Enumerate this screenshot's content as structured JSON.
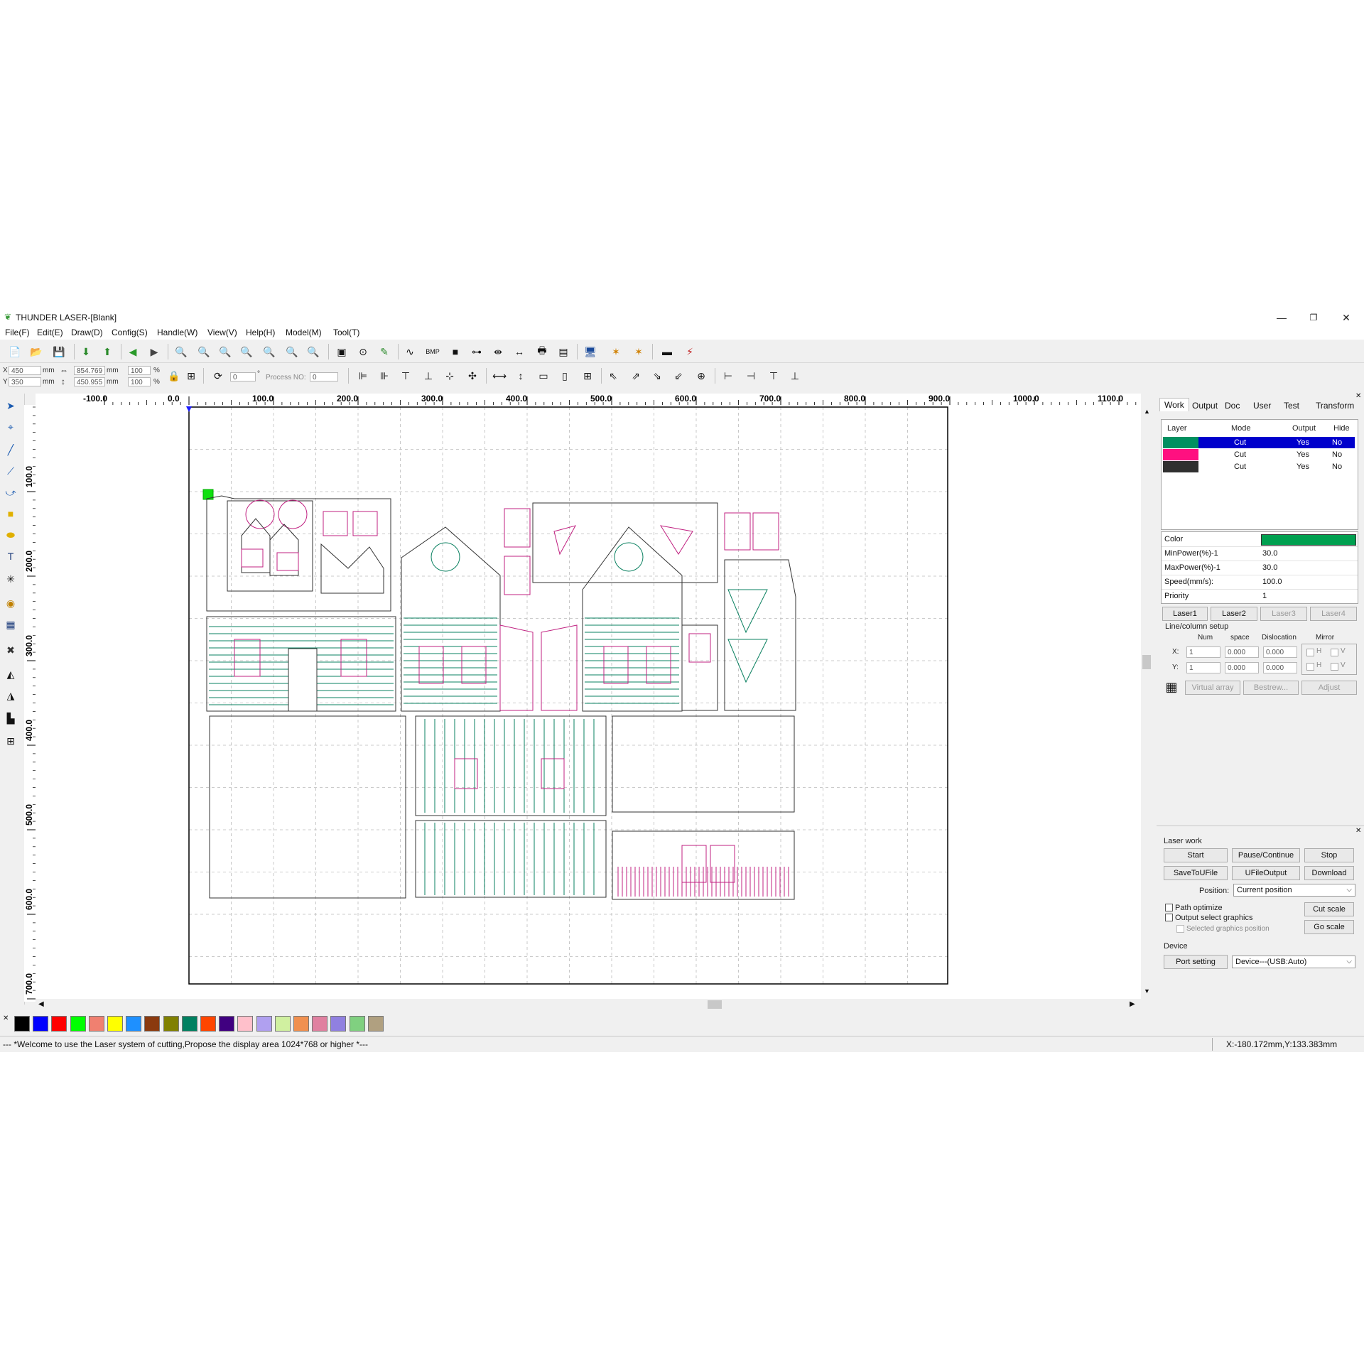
{
  "window": {
    "title": "THUNDER LASER-[Blank]",
    "minimize": "—",
    "maximize": "❐",
    "close": "✕"
  },
  "menu": [
    "File(F)",
    "Edit(E)",
    "Draw(D)",
    "Config(S)",
    "Handle(W)",
    "View(V)",
    "Help(H)",
    "Model(M)",
    "Tool(T)"
  ],
  "coords": {
    "x_label": "X",
    "x_value": "450",
    "x_unit": "mm",
    "y_label": "Y",
    "y_value": "350",
    "y_unit": "mm",
    "width_value": "854.769",
    "width_unit": "mm",
    "height_value": "450.955",
    "height_unit": "mm",
    "scale_w": "100",
    "scale_h": "100",
    "percent": "%",
    "rotate_value": "0",
    "degree": "°",
    "process_label": "Process NO:",
    "process_value": "0"
  },
  "ruler": {
    "h_labels": [
      "-100.0",
      "0.0",
      "100.0",
      "200.0",
      "300.0",
      "400.0",
      "500.0",
      "600.0",
      "700.0",
      "800.0",
      "900.0",
      "1000.0",
      "1100.0"
    ],
    "v_labels": [
      "100.0",
      "200.0",
      "300.0",
      "400.0",
      "500.0",
      "600.0",
      "700.0"
    ]
  },
  "palette_colors": [
    "#000000",
    "#0000ff",
    "#ff0000",
    "#00ff00",
    "#f08070",
    "#ffff00",
    "#1e90ff",
    "#8b3a0f",
    "#808000",
    "#008060",
    "#ff4500",
    "#400080",
    "#ffc0cb",
    "#b0a0f0",
    "#d0f0a0",
    "#f09050",
    "#e080a0",
    "#9080e0",
    "#80d080",
    "#b0a080"
  ],
  "status": {
    "message": "--- *Welcome to use the Laser system of cutting,Propose the display area 1024*768 or higher *---",
    "coordinates": "X:-180.172mm,Y:133.383mm"
  },
  "right_panel": {
    "tabs": [
      "Work",
      "Output",
      "Doc",
      "User",
      "Test",
      "Transform"
    ],
    "layer_headers": [
      "Layer",
      "Mode",
      "Output",
      "Hide"
    ],
    "layers": [
      {
        "color": "#009060",
        "mode": "Cut",
        "output": "Yes",
        "hide": "No"
      },
      {
        "color": "#ff1080",
        "mode": "Cut",
        "output": "Yes",
        "hide": "No"
      },
      {
        "color": "#303030",
        "mode": "Cut",
        "output": "Yes",
        "hide": "No"
      }
    ],
    "properties": [
      {
        "label": "Color",
        "value": ""
      },
      {
        "label": "MinPower(%)-1",
        "value": "30.0"
      },
      {
        "label": "MaxPower(%)-1",
        "value": "30.0"
      },
      {
        "label": "Speed(mm/s):",
        "value": "100.0"
      },
      {
        "label": "Priority",
        "value": "1"
      }
    ],
    "color_value": "#00a050",
    "laser_tabs": [
      "Laser1",
      "Laser2",
      "Laser3",
      "Laser4"
    ],
    "line_column": {
      "title": "Line/column setup",
      "headers": [
        "Num",
        "space",
        "Dislocation",
        "Mirror"
      ],
      "x_label": "X:",
      "y_label": "Y:",
      "x_num": "1",
      "x_space": "0.000",
      "x_disloc": "0.000",
      "y_num": "1",
      "y_space": "0.000",
      "y_disloc": "0.000",
      "mirror_h": "H",
      "mirror_v": "V"
    },
    "array_buttons": [
      "Virtual array",
      "Bestrew...",
      "Adjust"
    ],
    "laser_work": {
      "title": "Laser work",
      "start": "Start",
      "pause": "Pause/Continue",
      "stop": "Stop",
      "save": "SaveToUFile",
      "ufile": "UFileOutput",
      "download": "Download",
      "position_label": "Position:",
      "position_value": "Current position",
      "path_optimize": "Path optimize",
      "output_select": "Output select graphics",
      "selected_pos": "Selected graphics position",
      "cut_scale": "Cut scale",
      "go_scale": "Go scale"
    },
    "device": {
      "title": "Device",
      "port": "Port setting",
      "device_value": "Device---(USB:Auto)"
    }
  }
}
